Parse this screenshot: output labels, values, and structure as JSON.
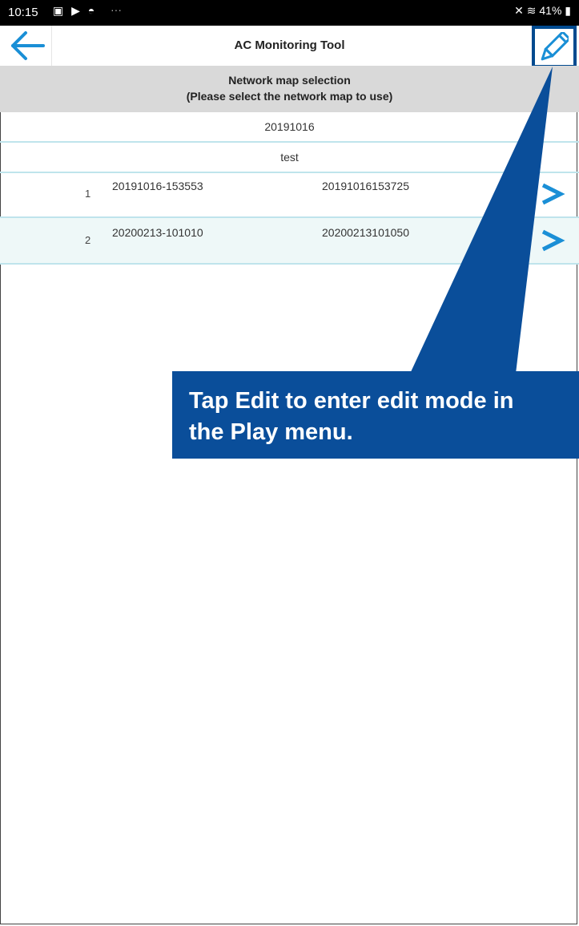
{
  "status_bar": {
    "time": "10:15",
    "notification_icons": "▣ ▶ ◓",
    "more": "···",
    "system_icons": "✕ ≋ 41% ▮"
  },
  "app_bar": {
    "title": "AC Monitoring Tool",
    "back_icon": "arrow-left-icon",
    "edit_icon": "pencil-icon",
    "accent_color": "#1a8fd6",
    "highlight_color": "#004a8f"
  },
  "list_header": {
    "line1": "Network map selection",
    "line2": "(Please select the network map to use)"
  },
  "groups": [
    "20191016",
    "test"
  ],
  "rows": [
    {
      "index": "1",
      "name": "20191016-153553",
      "date": "20191016153725"
    },
    {
      "index": "2",
      "name": "20200213-101010",
      "date": "20200213101050"
    }
  ],
  "callout": {
    "line1": "Tap Edit to enter edit mode in",
    "line2": "the Play menu.",
    "color": "#0a4e9a"
  }
}
